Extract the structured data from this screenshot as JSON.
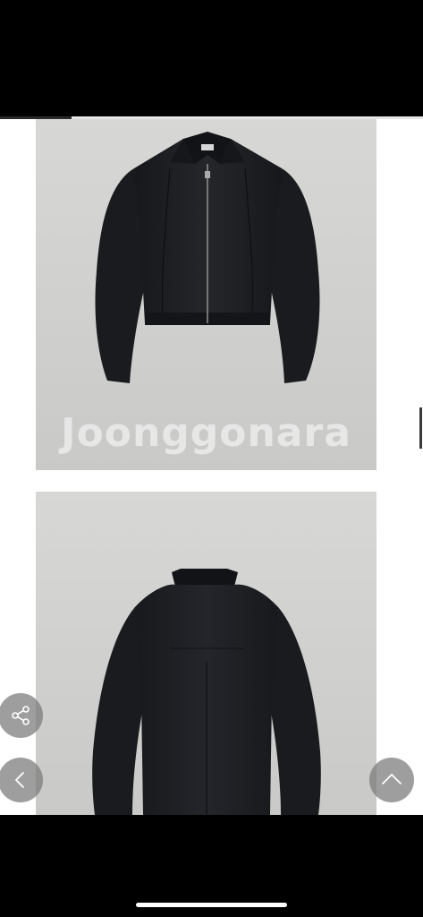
{
  "watermark": {
    "text": "Joonggonara"
  },
  "progress": {
    "fraction": 0.17
  },
  "icons": {
    "share": "share-icon",
    "back": "chevron-left-icon",
    "scroll_top": "chevron-up-icon"
  },
  "colors": {
    "background": "#000000",
    "photo_backdrop": "#d2d2d0",
    "jacket": "#1c1d20",
    "fab": "#787878"
  }
}
